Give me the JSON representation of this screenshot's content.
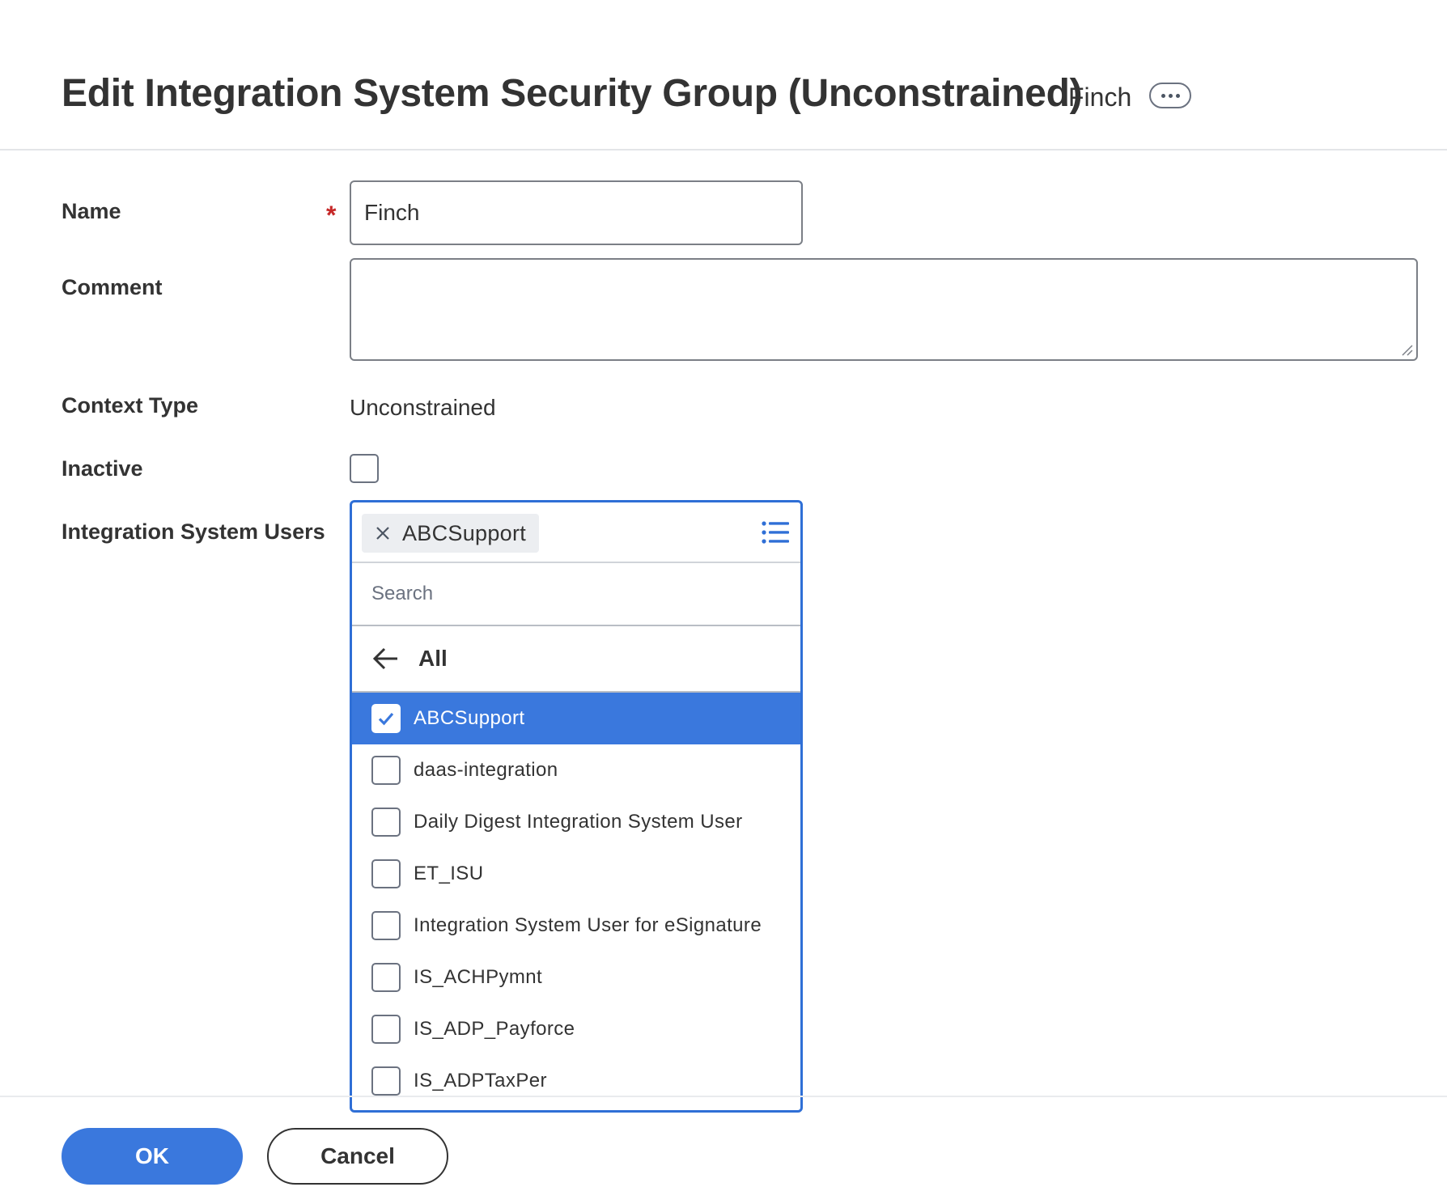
{
  "header": {
    "title": "Edit Integration System Security Group (Unconstrained)",
    "subject": "Finch",
    "related_actions_icon": "ellipsis-icon"
  },
  "form": {
    "name": {
      "label": "Name",
      "required_marker": "*",
      "value": "Finch"
    },
    "comment": {
      "label": "Comment",
      "value": ""
    },
    "context_type": {
      "label": "Context Type",
      "value": "Unconstrained"
    },
    "inactive": {
      "label": "Inactive",
      "checked": false
    },
    "integration_system_users": {
      "label": "Integration System Users",
      "selected_pills": [
        "ABCSupport"
      ],
      "search_placeholder": "Search",
      "back_label": "All",
      "options": [
        {
          "label": "ABCSupport",
          "checked": true
        },
        {
          "label": "daas-integration",
          "checked": false
        },
        {
          "label": "Daily Digest Integration System User",
          "checked": false
        },
        {
          "label": "ET_ISU",
          "checked": false
        },
        {
          "label": "Integration System User for eSignature",
          "checked": false
        },
        {
          "label": "IS_ACHPymnt",
          "checked": false
        },
        {
          "label": "IS_ADP_Payforce",
          "checked": false
        },
        {
          "label": "IS_ADPTaxPer",
          "checked": false
        }
      ]
    }
  },
  "footer": {
    "ok_label": "OK",
    "cancel_label": "Cancel"
  },
  "colors": {
    "accent": "#3a78dd",
    "prompt_border": "#2f6fd6",
    "required": "#c62828",
    "text": "#333333"
  }
}
